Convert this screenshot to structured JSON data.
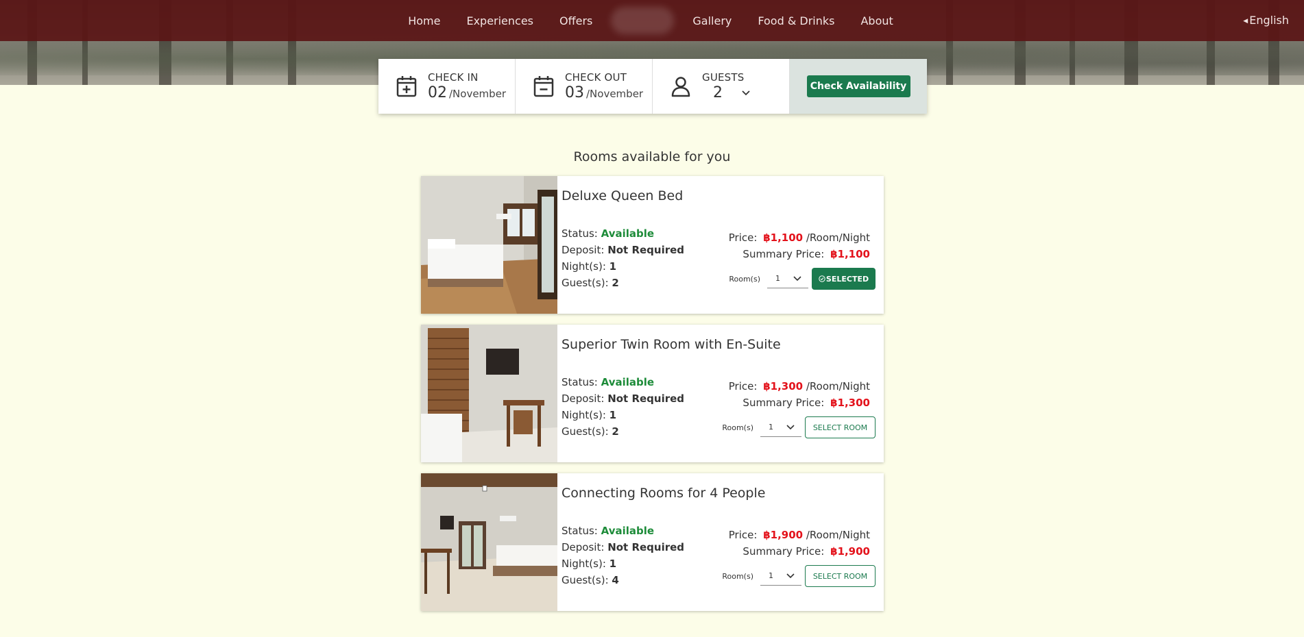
{
  "nav": {
    "items": [
      "Home",
      "Experiences",
      "Offers",
      "Gallery",
      "Food & Drinks",
      "About"
    ],
    "language": "English"
  },
  "booking": {
    "check_in_label": "CHECK IN",
    "check_in_day": "02",
    "check_in_month": "/November",
    "check_out_label": "CHECK OUT",
    "check_out_day": "03",
    "check_out_month": "/November",
    "guests_label": "GUESTS",
    "guests_value": "2",
    "check_button": "Check Availability"
  },
  "section_title": "Rooms available for you",
  "labels": {
    "status": "Status:",
    "deposit": "Deposit:",
    "nights": "Night(s):",
    "guests": "Guest(s):",
    "price": "Price:",
    "per_night": "/Room/Night",
    "summary": "Summary Price:",
    "rooms": "Room(s)"
  },
  "rooms": [
    {
      "name": "Deluxe Queen Bed",
      "status": "Available",
      "deposit": "Not Required",
      "nights": "1",
      "guests": "2",
      "price": "฿1,100",
      "summary_price": "฿1,100",
      "rooms_qty": "1",
      "button": "SELECTED",
      "selected": true
    },
    {
      "name": "Superior Twin Room with En-Suite",
      "status": "Available",
      "deposit": "Not Required",
      "nights": "1",
      "guests": "2",
      "price": "฿1,300",
      "summary_price": "฿1,300",
      "rooms_qty": "1",
      "button": "SELECT ROOM",
      "selected": false
    },
    {
      "name": "Connecting Rooms for 4 People",
      "status": "Available",
      "deposit": "Not Required",
      "nights": "1",
      "guests": "4",
      "price": "฿1,900",
      "summary_price": "฿1,900",
      "rooms_qty": "1",
      "button": "SELECT ROOM",
      "selected": false
    }
  ],
  "colors": {
    "nav_bg": "#5a1616",
    "page_bg": "#fcfde8",
    "accent_green": "#1b7a4e",
    "price_red": "#e3121b",
    "available_green": "#1e8c3a"
  }
}
